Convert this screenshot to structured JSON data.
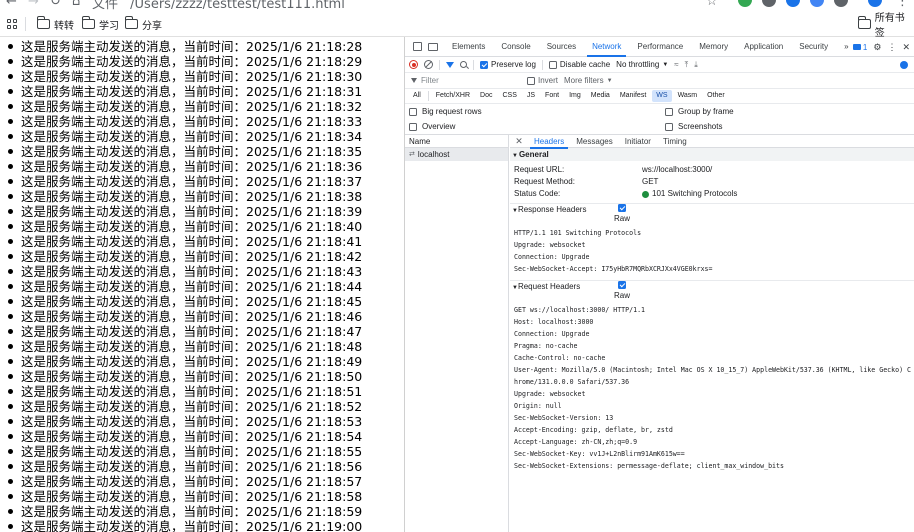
{
  "browser": {
    "address_scheme": "文件",
    "address_path": "/Users/zzzz/testtest/test111.html",
    "bookmarks": [
      {
        "label": "转转"
      },
      {
        "label": "学习"
      },
      {
        "label": "分享"
      }
    ],
    "all_bookmarks_label": "所有书签"
  },
  "page": {
    "message_prefix": "这是服务端主动发送的消息，当前时间：",
    "messages": [
      "这是服务端主动发送的消息，当前时间：2025/1/6 21:18:28",
      "这是服务端主动发送的消息，当前时间：2025/1/6 21:18:29",
      "这是服务端主动发送的消息，当前时间：2025/1/6 21:18:30",
      "这是服务端主动发送的消息，当前时间：2025/1/6 21:18:31",
      "这是服务端主动发送的消息，当前时间：2025/1/6 21:18:32",
      "这是服务端主动发送的消息，当前时间：2025/1/6 21:18:33",
      "这是服务端主动发送的消息，当前时间：2025/1/6 21:18:34",
      "这是服务端主动发送的消息，当前时间：2025/1/6 21:18:35",
      "这是服务端主动发送的消息，当前时间：2025/1/6 21:18:36",
      "这是服务端主动发送的消息，当前时间：2025/1/6 21:18:37",
      "这是服务端主动发送的消息，当前时间：2025/1/6 21:18:38",
      "这是服务端主动发送的消息，当前时间：2025/1/6 21:18:39",
      "这是服务端主动发送的消息，当前时间：2025/1/6 21:18:40",
      "这是服务端主动发送的消息，当前时间：2025/1/6 21:18:41",
      "这是服务端主动发送的消息，当前时间：2025/1/6 21:18:42",
      "这是服务端主动发送的消息，当前时间：2025/1/6 21:18:43",
      "这是服务端主动发送的消息，当前时间：2025/1/6 21:18:44",
      "这是服务端主动发送的消息，当前时间：2025/1/6 21:18:45",
      "这是服务端主动发送的消息，当前时间：2025/1/6 21:18:46",
      "这是服务端主动发送的消息，当前时间：2025/1/6 21:18:47",
      "这是服务端主动发送的消息，当前时间：2025/1/6 21:18:48",
      "这是服务端主动发送的消息，当前时间：2025/1/6 21:18:49",
      "这是服务端主动发送的消息，当前时间：2025/1/6 21:18:50",
      "这是服务端主动发送的消息，当前时间：2025/1/6 21:18:51",
      "这是服务端主动发送的消息，当前时间：2025/1/6 21:18:52",
      "这是服务端主动发送的消息，当前时间：2025/1/6 21:18:53",
      "这是服务端主动发送的消息，当前时间：2025/1/6 21:18:54",
      "这是服务端主动发送的消息，当前时间：2025/1/6 21:18:55",
      "这是服务端主动发送的消息，当前时间：2025/1/6 21:18:56",
      "这是服务端主动发送的消息，当前时间：2025/1/6 21:18:57",
      "这是服务端主动发送的消息，当前时间：2025/1/6 21:18:58",
      "这是服务端主动发送的消息，当前时间：2025/1/6 21:18:59",
      "这是服务端主动发送的消息，当前时间：2025/1/6 21:19:00"
    ]
  },
  "devtools": {
    "tabs": [
      "Elements",
      "Console",
      "Sources",
      "Network",
      "Performance",
      "Memory",
      "Application",
      "Security"
    ],
    "active_tab": "Network",
    "more_tabs": "»",
    "issues_count": "1",
    "toolbar": {
      "preserve_log": "Preserve log",
      "disable_cache": "Disable cache",
      "throttling": "No throttling"
    },
    "filter": {
      "placeholder": "Filter",
      "invert": "Invert",
      "more_filters": "More filters"
    },
    "types": [
      "All",
      "Fetch/XHR",
      "Doc",
      "CSS",
      "JS",
      "Font",
      "Img",
      "Media",
      "Manifest",
      "WS",
      "Wasm",
      "Other"
    ],
    "selected_type": "WS",
    "options": {
      "big_request_rows": "Big request rows",
      "overview": "Overview",
      "group_by_frame": "Group by frame",
      "screenshots": "Screenshots"
    },
    "request_list": {
      "name_header": "Name",
      "rows": [
        "localhost"
      ]
    },
    "detail_tabs": [
      "Headers",
      "Messages",
      "Initiator",
      "Timing"
    ],
    "active_detail_tab": "Headers",
    "general": {
      "title": "General",
      "request_url_label": "Request URL:",
      "request_url": "ws://localhost:3000/",
      "request_method_label": "Request Method:",
      "request_method": "GET",
      "status_code_label": "Status Code:",
      "status_code": "101 Switching Protocols"
    },
    "response_headers": {
      "title": "Response Headers",
      "raw_label": "Raw",
      "lines": [
        "HTTP/1.1 101 Switching Protocols",
        "Upgrade: websocket",
        "Connection: Upgrade",
        "Sec-WebSocket-Accept: I75yHbR7MQRbXCRJXx4VGE0krxs="
      ]
    },
    "request_headers": {
      "title": "Request Headers",
      "raw_label": "Raw",
      "lines": [
        "GET ws://localhost:3000/ HTTP/1.1",
        "Host: localhost:3000",
        "Connection: Upgrade",
        "Pragma: no-cache",
        "Cache-Control: no-cache",
        "User-Agent: Mozilla/5.0 (Macintosh; Intel Mac OS X 10_15_7) AppleWebKit/537.36 (KHTML, like Gecko) C",
        "hrome/131.0.0.0 Safari/537.36",
        "Upgrade: websocket",
        "Origin: null",
        "Sec-WebSocket-Version: 13",
        "Accept-Encoding: gzip, deflate, br, zstd",
        "Accept-Language: zh-CN,zh;q=0.9",
        "Sec-WebSocket-Key: vv1J+L2nBlirm91AmK615w==",
        "Sec-WebSocket-Extensions: permessage-deflate; client_max_window_bits"
      ]
    }
  }
}
